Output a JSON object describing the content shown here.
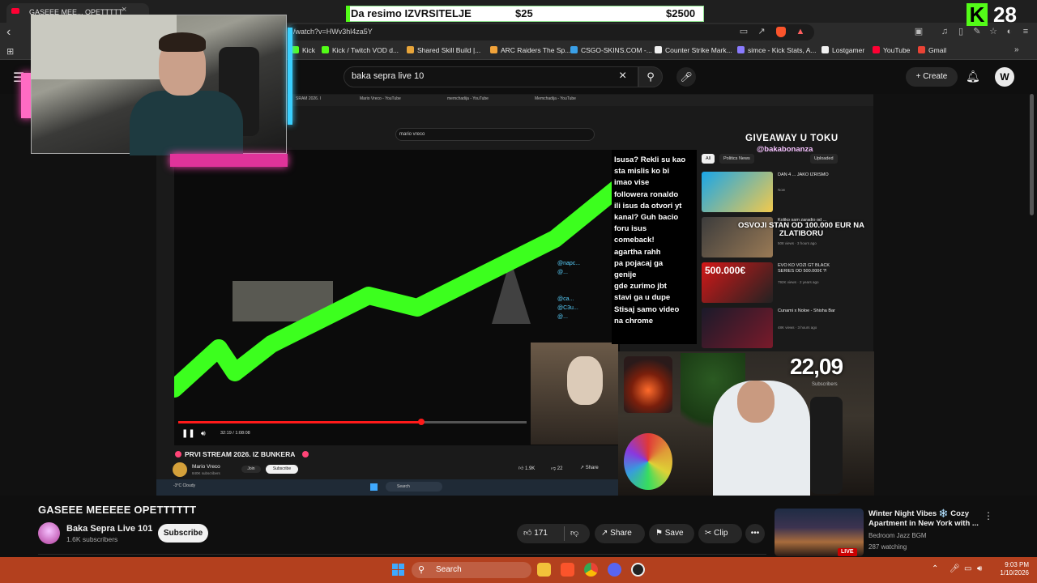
{
  "browser": {
    "tab_title": "GASEEE MEE... OPETTTTT",
    "url": "/watch?v=HWv3hl4za5Y",
    "bookmarks": [
      {
        "label": "Kick",
        "color": "#53fc18"
      },
      {
        "label": "Kick / Twitch VOD d...",
        "color": "#53fc18"
      },
      {
        "label": "Shared Skill Build |...",
        "color": "#e8a53a"
      },
      {
        "label": "ARC Raiders The Sp...",
        "color": "#f2a33a"
      },
      {
        "label": "CSGO-SKINS.COM -...",
        "color": "#3aa0e8"
      },
      {
        "label": "Counter Strike Mark...",
        "color": "#f1f1f1"
      },
      {
        "label": "simce - Kick Stats, A...",
        "color": "#8a7bff"
      },
      {
        "label": "Lostgamer",
        "color": "#f1f1f1"
      },
      {
        "label": "YouTube",
        "color": "#ff0033"
      },
      {
        "label": "Gmail",
        "color": "#ea4335"
      }
    ]
  },
  "masthead": {
    "search_query": "baka sepra live 10",
    "create_label": "Create",
    "avatar_letter": "W"
  },
  "overlay": {
    "prize_label": "Da resimo IZVRSITELJE",
    "prize_amount": "$25",
    "prize_goal": "$2500",
    "kick_count": "28",
    "giveaway_title": "GIVEAWAY U TOKU",
    "giveaway_handle": "@bakabonanza",
    "zlatibor_text": "OSVOJI STAN OD 100.000 EUR NA ZLATIBORU",
    "sub_count": "22,09",
    "sub_count_label": "Subscribers"
  },
  "inner_video": {
    "search_text": "mario vreco",
    "time": "32:19 / 1:08:08",
    "title": "PRVI STREAM 2026. IZ BUNKERA",
    "channel_name": "Mario Vreco",
    "channel_subs": "840K subscribers",
    "join_label": "Join",
    "subscribe_label": "Subscribe",
    "likes": "1.9K",
    "dislike_count": "22",
    "share_label": "Share",
    "taskbar_search": "Search",
    "weather": "-3°C Cloudy",
    "tabs": [
      "SRAM 2026. I",
      "Mario Vreco - YouTube",
      "memchadija - YouTube",
      "Memchadija - YouTube"
    ],
    "chips": [
      "All",
      "Politics News",
      "Uploaded"
    ],
    "recommendations": [
      {
        "title": "DAN 4 ... JAKO IZRISMO",
        "meta": "Now"
      },
      {
        "title": "Koliko sam zaradio od ...",
        "meta": "508 views · 3 hours ago"
      },
      {
        "title": "EVO KO VOZI GT BLACK SERIES OD 500.000€ ?!",
        "meta": "792K views · 2 years ago"
      },
      {
        "title": "Cunami x Noloe - Shisha Bar",
        "meta": "48K views · 3 hours ago"
      }
    ]
  },
  "chat": {
    "lines": [
      "Isusa? Rekli su kao",
      "sta mislis ko bi",
      "imao vise",
      "followera ronaldo",
      "ili isus da otvori yt",
      "kanal? Guh bacio",
      "foru isus",
      "comeback!",
      "agartha rahh",
      "pa pojacaj ga",
      "genije",
      "gde zurimo jbt",
      "stavi ga u dupe",
      "Stisaj samo video",
      "na chrome"
    ]
  },
  "video": {
    "title": "GASEEE MEEEEE OPETTTTTT",
    "channel_name": "Baka Sepra Live 101",
    "channel_subs": "1.6K subscribers",
    "subscribe_label": "Subscribe",
    "likes": "171",
    "share_label": "Share",
    "save_label": "Save",
    "clip_label": "Clip"
  },
  "up_next": {
    "title": "Winter Night Vibes ❄️ Cozy Apartment in New York with ...",
    "channel": "Bedroom Jazz BGM",
    "watching": "287 watching",
    "live_label": "LIVE"
  },
  "taskbar": {
    "search_label": "Search",
    "time": "9:03 PM",
    "date": "1/10/2026"
  },
  "colors": {
    "kick_green": "#53fc18",
    "youtube_red": "#ff0033",
    "taskbar": "#b3401e"
  }
}
